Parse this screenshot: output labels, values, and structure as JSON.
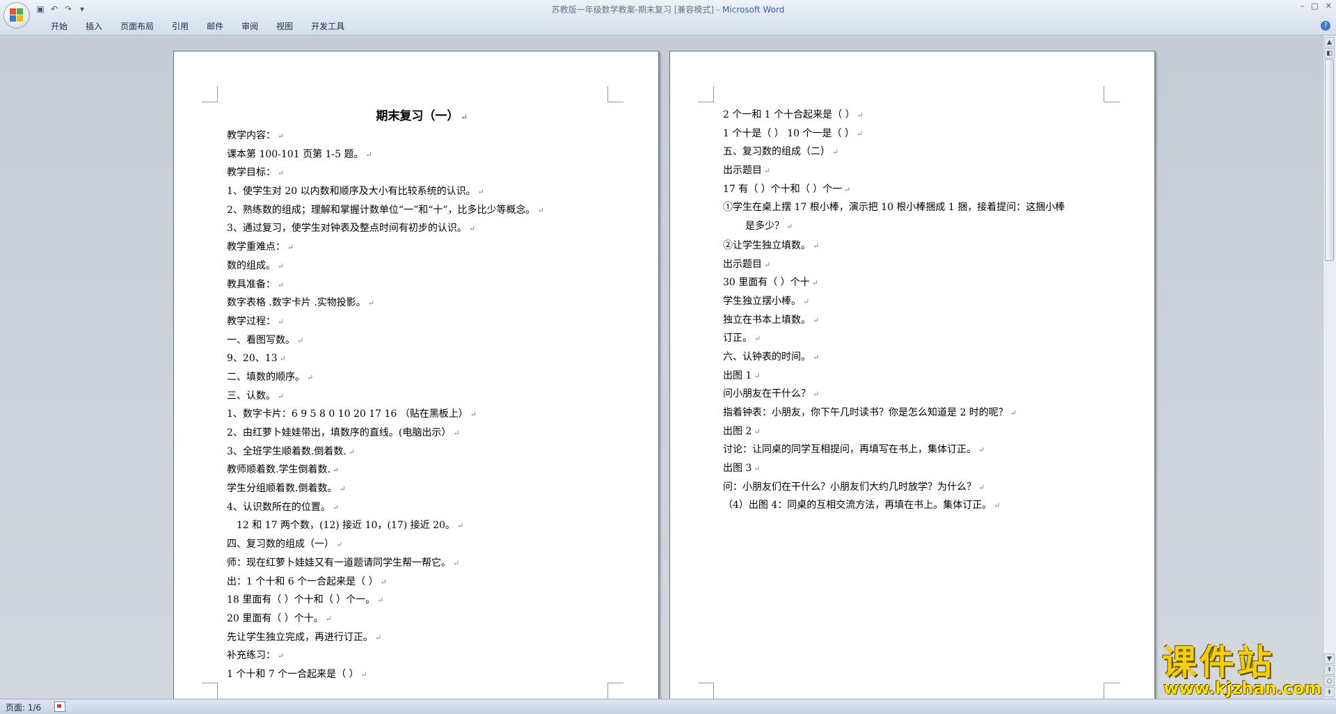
{
  "window": {
    "title_doc": "苏教版一年级数学教案-期末复习 [兼容模式]",
    "title_sep": " - ",
    "title_app": "Microsoft Word",
    "controls": [
      "–",
      "□",
      "✕"
    ]
  },
  "qat": {
    "icons": [
      "save-icon",
      "undo-icon",
      "redo-icon",
      "customize-icon"
    ],
    "glyphs": [
      "▣",
      "↶",
      "↷",
      "▾"
    ]
  },
  "ribbon": {
    "tabs": [
      "开始",
      "插入",
      "页面布局",
      "引用",
      "邮件",
      "审阅",
      "视图",
      "开发工具"
    ],
    "help": "?"
  },
  "page1": {
    "title": "期末复习（一）",
    "lines": [
      "教学内容：",
      "课本第 100-101 页第 1-5 题。",
      "教学目标：",
      "1、使学生对 20 以内数和顺序及大小有比较系统的认识。",
      "2、熟练数的组成；理解和掌握计数单位“一”和“十”，比多比少等概念。",
      "3、通过复习，使学生对钟表及整点时间有初步的认识。",
      "教学重难点：",
      "数的组成。",
      "教具准备：",
      "数字表格 .数字卡片 .实物投影。",
      "教学过程：",
      "一、看图写数。",
      "9、20、13",
      "二、填数的顺序。",
      "三、认数。",
      "1、数字卡片：6   9   5   8   0   10   20   17   16  （贴在黑板上）",
      "2、由红萝卜娃娃带出，填数序的直线。(电脑出示）",
      "3、全班学生顺着数.倒着数.",
      "教师顺着数.学生倒着数.",
      "学生分组顺着数.倒着数。",
      "4、认识数所在的位置。",
      "12 和 17 两个数，(12) 接近 10，(17) 接近 20。",
      "四、复习数的组成（一）",
      "师：现在红萝卜娃娃又有一道题请同学生帮一帮它。",
      "出：1 个十和 6 个一合起来是（     ）",
      "18 里面有（   ）个十和（   ）个一。",
      "20 里面有（     ）个十。",
      "先让学生独立完成，再进行订正。",
      "补充练习：",
      "1 个十和 7 个一合起来是（     ）"
    ]
  },
  "page2": {
    "lines_a": [
      "2 个一和 1 个十合起来是（     ）",
      "1 个十是（     ）    10 个一是（     ）",
      "五、复习数的组成（二）",
      "出示题目",
      "17 有（   ）个十和（     ）个一"
    ],
    "wrap_line": "①学生在桌上摆 17 根小棒，演示把 10 根小棒捆成 1 捆，接着提问：这捆小棒",
    "wrap_cont": "是多少？",
    "lines_b": [
      "②让学生独立填数。",
      "出示题目",
      "30 里面有（     ）个十",
      "学生独立摆小棒。",
      "独立在书本上填数。",
      "订正。",
      "六、认钟表的时间。",
      "出图 1",
      "问小朋友在干什么？",
      "指着钟表：小朋友，你下午几时读书？你是怎么知道是 2 时的呢？",
      "出图 2",
      "讨论：让同桌的同学互相提问，再填写在书上，集体订正。",
      "出图 3",
      "问：小朋友们在干什么？小朋友们大约几时放学？为什么？",
      "（4）出图 4：同桌的互相交流方法，再填在书上。集体订正。"
    ]
  },
  "paragraph_mark": "↵",
  "statusbar": {
    "page_info": "页面: 1/6"
  },
  "watermark": {
    "text1": "课件站",
    "text2": "www.kjzhan.com"
  },
  "colors": {
    "accent": "#3d5fa8",
    "watermark": "#f5d000"
  }
}
